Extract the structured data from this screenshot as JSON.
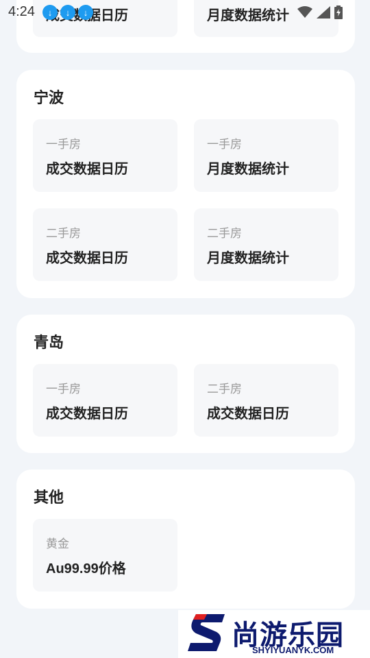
{
  "status": {
    "time": "4:24"
  },
  "sections": [
    {
      "title": "",
      "tiles": [
        {
          "sub": "",
          "main": "成交数据日历"
        },
        {
          "sub": "",
          "main": "月度数据统计"
        }
      ]
    },
    {
      "title": "宁波",
      "tiles": [
        {
          "sub": "一手房",
          "main": "成交数据日历"
        },
        {
          "sub": "一手房",
          "main": "月度数据统计"
        },
        {
          "sub": "二手房",
          "main": "成交数据日历"
        },
        {
          "sub": "二手房",
          "main": "月度数据统计"
        }
      ]
    },
    {
      "title": "青岛",
      "tiles": [
        {
          "sub": "一手房",
          "main": "成交数据日历"
        },
        {
          "sub": "二手房",
          "main": "成交数据日历"
        }
      ]
    },
    {
      "title": "其他",
      "tiles": [
        {
          "sub": "黄金",
          "main": "Au99.99价格"
        }
      ]
    }
  ],
  "watermark": {
    "brand": "尚游乐园",
    "url": "SHYIYUANYK.COM",
    "color": "#0d1a6e",
    "accent": "#e02020"
  }
}
